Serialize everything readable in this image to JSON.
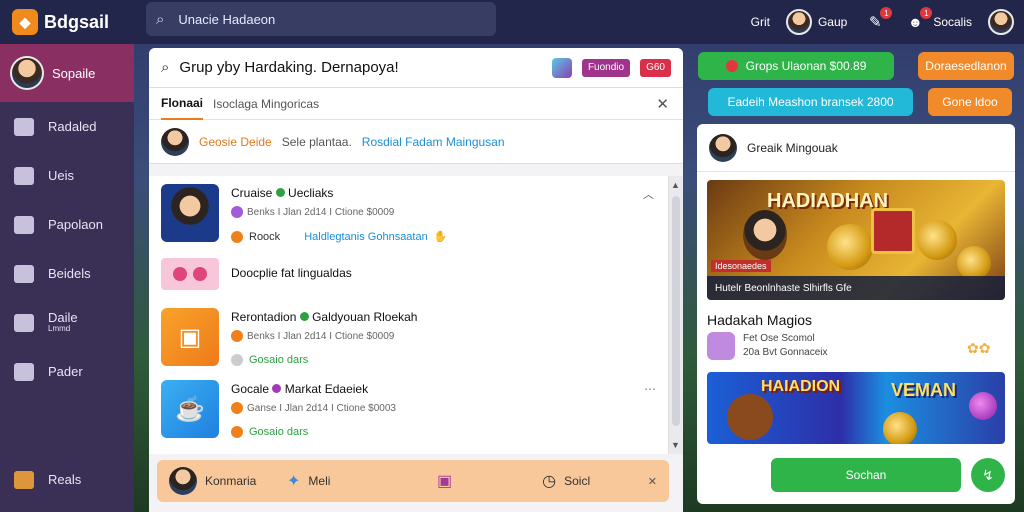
{
  "app": {
    "name": "Bdgsail"
  },
  "search": {
    "text": "Unacie Hadaeon"
  },
  "topbar": {
    "item1": "Grit",
    "item2": "Gaup",
    "badge1": "1",
    "badge2": "1",
    "item4": "Socalis"
  },
  "sidebar": {
    "active": "Sopaile",
    "items": [
      {
        "label": "Radaled",
        "icon": "inbox-icon"
      },
      {
        "label": "Ueis",
        "icon": "users-icon"
      },
      {
        "label": "Papolaon",
        "icon": "bird-icon"
      },
      {
        "label": "Beidels",
        "icon": "phone-icon"
      },
      {
        "label": "Daile",
        "sub": "Lmmd",
        "icon": "chart-icon"
      },
      {
        "label": "Pader",
        "icon": "cart-icon"
      }
    ],
    "bottom": "Reals"
  },
  "panel": {
    "title": "Grup yby Hardaking. Dernapoya!",
    "pill1": "Fuondio",
    "pill2": "G60",
    "tab_active": "Flonaai",
    "tab_other": "Isoclaga Mingoricas",
    "user_name": "Geosie Deide",
    "user_text": "Sele plantaa.",
    "user_link": "Rosdial Fadam Maingusan"
  },
  "rows": [
    {
      "title": "Cruaise",
      "title_b": "Uecliaks",
      "meta": "Benks I Jlan 2d14 I Ctione $0009",
      "m2a": "Roock",
      "m2b": "Haldlegtanis Gohnsaatan"
    },
    {
      "title": "Doocplie fat lingualdas"
    },
    {
      "title": "Rerontadion",
      "title_b": "Galdyouan Rloekah",
      "meta": "Benks I Jlan 2d14 I Ctione $0009",
      "m2a": "Gosaio dars"
    },
    {
      "title": "Gocale",
      "title_b": "Markat Edaeiek",
      "meta": "Ganse I Jlan 2d14 I Ctione $0003",
      "m2a": "Gosaio dars"
    }
  ],
  "bottombar": {
    "a": "Konmaria",
    "b": "Meli",
    "c": "Soicl"
  },
  "right": {
    "btn1": "Grops Ulaonan $00.89",
    "btn2": "Doraesedlanon",
    "btn3": "Eadeih Meashon bransek 2800",
    "btn4": "Gone ldoo",
    "head": "Greaik Mingouak",
    "banner1_title": "HADIADHAN",
    "banner1_cap": "Hutelr Beonlnhaste Slhirfls Gfe",
    "banner1_tag": "Idesonaedes",
    "section_title": "Hadakah Magios",
    "sec_line1": "Fet Ose Scomol",
    "sec_line2": "20a Bvt Gonnaceix",
    "banner2_a": "HAIADION",
    "banner2_b": "VEMAN",
    "go": "Sochan"
  }
}
